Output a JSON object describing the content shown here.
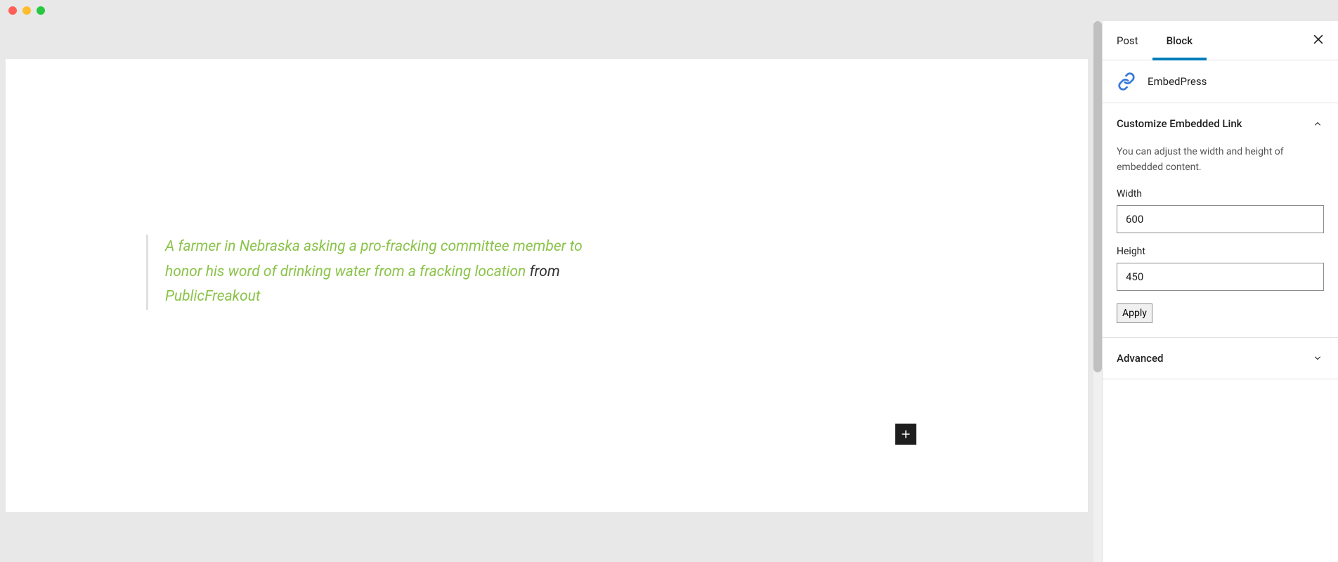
{
  "sidebar": {
    "tabs": {
      "post": "Post",
      "block": "Block"
    },
    "block_name": "EmbedPress",
    "customize": {
      "title": "Customize Embedded Link",
      "description": "You can adjust the width and height of embedded content.",
      "width_label": "Width",
      "width_value": "600",
      "height_label": "Height",
      "height_value": "450",
      "apply_label": "Apply"
    },
    "advanced": {
      "title": "Advanced"
    }
  },
  "editor": {
    "embed": {
      "link_text": "A farmer in Nebraska asking a pro-fracking committee member to honor his word of drinking water from a fracking location",
      "from_text": " from ",
      "source_text": "PublicFreakout"
    }
  }
}
